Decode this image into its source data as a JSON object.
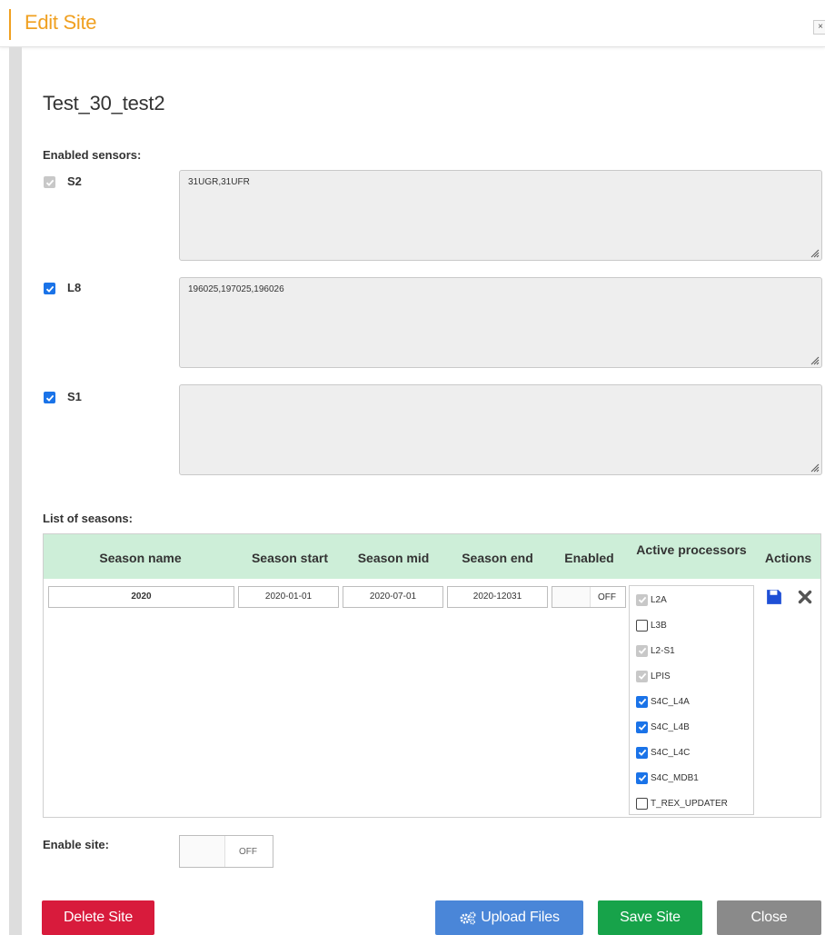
{
  "dialog": {
    "title": "Edit Site",
    "close_glyph": "×"
  },
  "site": {
    "name": "Test_30_test2"
  },
  "sensors": {
    "label": "Enabled sensors:",
    "items": [
      {
        "name": "S2",
        "checked": true,
        "disabled": true,
        "tiles": "31UGR,31UFR"
      },
      {
        "name": "L8",
        "checked": true,
        "disabled": false,
        "tiles": "196025,197025,196026"
      },
      {
        "name": "S1",
        "checked": true,
        "disabled": false,
        "tiles": ""
      }
    ]
  },
  "seasons": {
    "label": "List of seasons:",
    "columns": {
      "name": "Season name",
      "start": "Season start",
      "mid": "Season mid",
      "end": "Season end",
      "enabled": "Enabled",
      "processors": "Active processors",
      "actions": "Actions"
    },
    "rows": [
      {
        "name": "2020",
        "start": "2020-01-01",
        "mid": "2020-07-01",
        "end": "2020-12031",
        "enabled": "OFF",
        "processors": [
          {
            "label": "L2A",
            "state": "checked-disabled"
          },
          {
            "label": "L3B",
            "state": "unchecked"
          },
          {
            "label": "L2-S1",
            "state": "checked-disabled"
          },
          {
            "label": "LPIS",
            "state": "checked-disabled"
          },
          {
            "label": "S4C_L4A",
            "state": "checked"
          },
          {
            "label": "S4C_L4B",
            "state": "checked"
          },
          {
            "label": "S4C_L4C",
            "state": "checked"
          },
          {
            "label": "S4C_MDB1",
            "state": "checked"
          },
          {
            "label": "T_REX_UPDATER",
            "state": "unchecked"
          }
        ]
      }
    ]
  },
  "enable_site": {
    "label": "Enable site:",
    "value": "OFF"
  },
  "footer": {
    "delete_label": "Delete Site",
    "upload_label": "Upload Files",
    "save_label": "Save Site",
    "close_label": "Close"
  },
  "colors": {
    "accent": "#f0a020",
    "header_row": "#cdeed8",
    "checkbox": "#1a73e8",
    "delete": "#d81b3c",
    "upload": "#4a86d8",
    "save": "#17a34a",
    "close": "#8a8a8a"
  },
  "icons": {
    "upload": "cogs-icon",
    "save_row": "floppy-icon",
    "delete_row": "close-icon"
  }
}
